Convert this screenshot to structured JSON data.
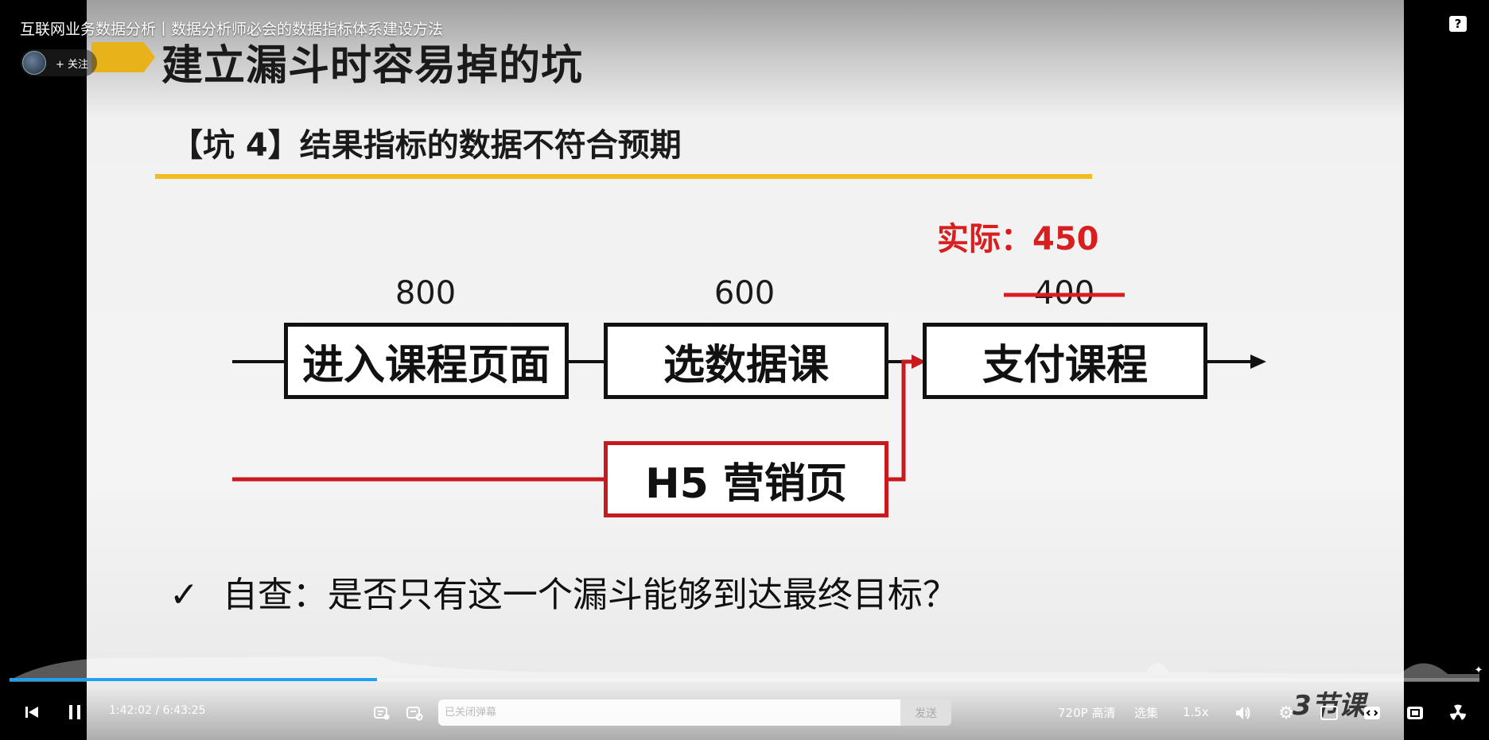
{
  "video": {
    "title": "互联网业务数据分析丨数据分析师必会的数据指标体系建设方法",
    "follow_label": "+ 关注",
    "help_icon": "?"
  },
  "slide": {
    "title": "建立漏斗时容易掉的坑",
    "subtitle": "【坑 4】结果指标的数据不符合预期",
    "actual_label": "实际：450",
    "steps": [
      {
        "count": "800",
        "label": "进入课程页面"
      },
      {
        "count": "600",
        "label": "选数据课"
      },
      {
        "count": "400",
        "label": "支付课程"
      }
    ],
    "side_entry": "H5 营销页",
    "check_mark": "✓",
    "check_text": "自查：是否只有这一个漏斗能够到达最终目标？",
    "colors": {
      "accent_yellow": "#f1bc1d",
      "accent_red": "#c8191f"
    }
  },
  "controls": {
    "current_time": "1:42:02",
    "separator": "/",
    "duration": "6:43:25",
    "progress_fraction": 0.25,
    "danmaku_placeholder": "已关闭弹幕",
    "send_label": "发送",
    "quality_label": "720P 高清",
    "episodes_label": "选集",
    "speed_label": "1.5x",
    "brand_watermark": "3节课"
  }
}
